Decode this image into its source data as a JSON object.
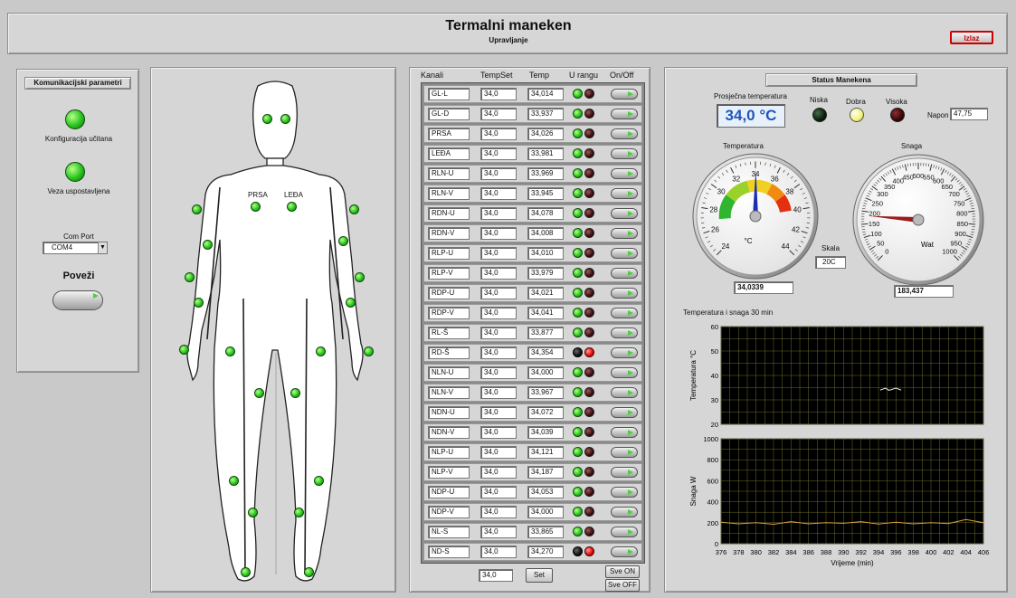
{
  "header": {
    "title": "Termalni maneken",
    "subtitle": "Upravljanje",
    "exit_label": "Izlaz"
  },
  "comm": {
    "title": "Komunikacijski parametri",
    "config_loaded": "Konfiguracija učitana",
    "connected": "Veza uspostavljena",
    "com_port_label": "Com Port",
    "com_port_value": "COM4",
    "connect_label": "Poveži"
  },
  "body_labels": {
    "chest": "PRSA",
    "back": "LEĐA"
  },
  "channels": {
    "headers": {
      "kanali": "Kanali",
      "tempset": "TempSet",
      "temp": "Temp",
      "in_range": "U rangu",
      "onoff": "On/Off"
    },
    "rows": [
      {
        "name": "GL-L",
        "set": "34,0",
        "temp": "34,014",
        "in_range": true
      },
      {
        "name": "GL-D",
        "set": "34,0",
        "temp": "33,937",
        "in_range": true
      },
      {
        "name": "PRSA",
        "set": "34,0",
        "temp": "34,026",
        "in_range": true
      },
      {
        "name": "LEĐA",
        "set": "34,0",
        "temp": "33,981",
        "in_range": true
      },
      {
        "name": "RLN-U",
        "set": "34,0",
        "temp": "33,969",
        "in_range": true
      },
      {
        "name": "RLN-V",
        "set": "34,0",
        "temp": "33,945",
        "in_range": true
      },
      {
        "name": "RDN-U",
        "set": "34,0",
        "temp": "34,078",
        "in_range": true
      },
      {
        "name": "RDN-V",
        "set": "34,0",
        "temp": "34,008",
        "in_range": true
      },
      {
        "name": "RLP-U",
        "set": "34,0",
        "temp": "34,010",
        "in_range": true
      },
      {
        "name": "RLP-V",
        "set": "34,0",
        "temp": "33,979",
        "in_range": true
      },
      {
        "name": "RDP-U",
        "set": "34,0",
        "temp": "34,021",
        "in_range": true
      },
      {
        "name": "RDP-V",
        "set": "34,0",
        "temp": "34,041",
        "in_range": true
      },
      {
        "name": "RL-Š",
        "set": "34,0",
        "temp": "33,877",
        "in_range": true
      },
      {
        "name": "RD-Š",
        "set": "34,0",
        "temp": "34,354",
        "in_range": false
      },
      {
        "name": "NLN-U",
        "set": "34,0",
        "temp": "34,000",
        "in_range": true
      },
      {
        "name": "NLN-V",
        "set": "34,0",
        "temp": "33,967",
        "in_range": true
      },
      {
        "name": "NDN-U",
        "set": "34,0",
        "temp": "34,072",
        "in_range": true
      },
      {
        "name": "NDN-V",
        "set": "34,0",
        "temp": "34,039",
        "in_range": true
      },
      {
        "name": "NLP-U",
        "set": "34,0",
        "temp": "34,121",
        "in_range": true
      },
      {
        "name": "NLP-V",
        "set": "34,0",
        "temp": "34,187",
        "in_range": true
      },
      {
        "name": "NDP-U",
        "set": "34,0",
        "temp": "34,053",
        "in_range": true
      },
      {
        "name": "NDP-V",
        "set": "34,0",
        "temp": "34,000",
        "in_range": true
      },
      {
        "name": "NL-S",
        "set": "34,0",
        "temp": "33,865",
        "in_range": true
      },
      {
        "name": "ND-S",
        "set": "34,0",
        "temp": "34,270",
        "in_range": false
      }
    ],
    "all_set_value": "34,0",
    "set_label": "Set",
    "all_on": "Sve ON",
    "all_off": "Sve OFF"
  },
  "status": {
    "title": "Status Manekena",
    "avg_label": "Prosječna temperatura",
    "avg_value": "34,0 °C",
    "niska": "Niska",
    "dobra": "Dobra",
    "visoka": "Visoka",
    "napon_label": "Napon",
    "napon_value": "47,75",
    "skala_label": "Skala",
    "skala_value": "20C"
  },
  "temp_gauge": {
    "title": "Temperatura",
    "unit": "°C",
    "min": 24,
    "max": 44,
    "value": 34.0339,
    "value_text": "34,0339",
    "ticks": [
      "24",
      "26",
      "28",
      "30",
      "32",
      "34",
      "36",
      "38",
      "40",
      "42",
      "44"
    ]
  },
  "power_gauge": {
    "title": "Snaga",
    "unit": "Wat",
    "min": 0,
    "max": 1000,
    "value": 183.437,
    "value_text": "183,437",
    "ticks": [
      "0",
      "50",
      "100",
      "150",
      "200",
      "250",
      "300",
      "350",
      "400",
      "450",
      "500",
      "550",
      "600",
      "650",
      "700",
      "750",
      "800",
      "850",
      "900",
      "950",
      "1000"
    ]
  },
  "chart_data": {
    "type": "line",
    "title": "Temperatura i snaga 30 min",
    "xlabel": "Vrijeme (min)",
    "x_ticks": [
      "376",
      "378",
      "380",
      "382",
      "384",
      "386",
      "388",
      "390",
      "392",
      "394",
      "396",
      "398",
      "400",
      "402",
      "404",
      "406"
    ],
    "xlim": [
      376,
      406
    ],
    "panels": [
      {
        "ylabel": "Temperatura °C",
        "ylim": [
          20,
          60
        ],
        "y_ticks": [
          "20",
          "30",
          "40",
          "50",
          "60"
        ],
        "x": [
          376,
          386,
          393.8,
          394.2,
          394.8,
          395.2,
          396,
          396.6,
          406
        ],
        "y": [
          null,
          null,
          null,
          34.0,
          34.8,
          33.9,
          34.8,
          34.0,
          null
        ]
      },
      {
        "ylabel": "Snaga W",
        "ylim": [
          0,
          1000
        ],
        "y_ticks": [
          "0",
          "200",
          "400",
          "600",
          "800",
          "1000"
        ],
        "x": [
          376,
          378,
          380,
          382,
          384,
          386,
          388,
          390,
          392,
          394,
          396,
          398,
          400,
          402,
          404,
          406
        ],
        "y": [
          205,
          190,
          200,
          185,
          210,
          190,
          200,
          195,
          210,
          188,
          205,
          190,
          200,
          192,
          230,
          200
        ]
      }
    ]
  }
}
